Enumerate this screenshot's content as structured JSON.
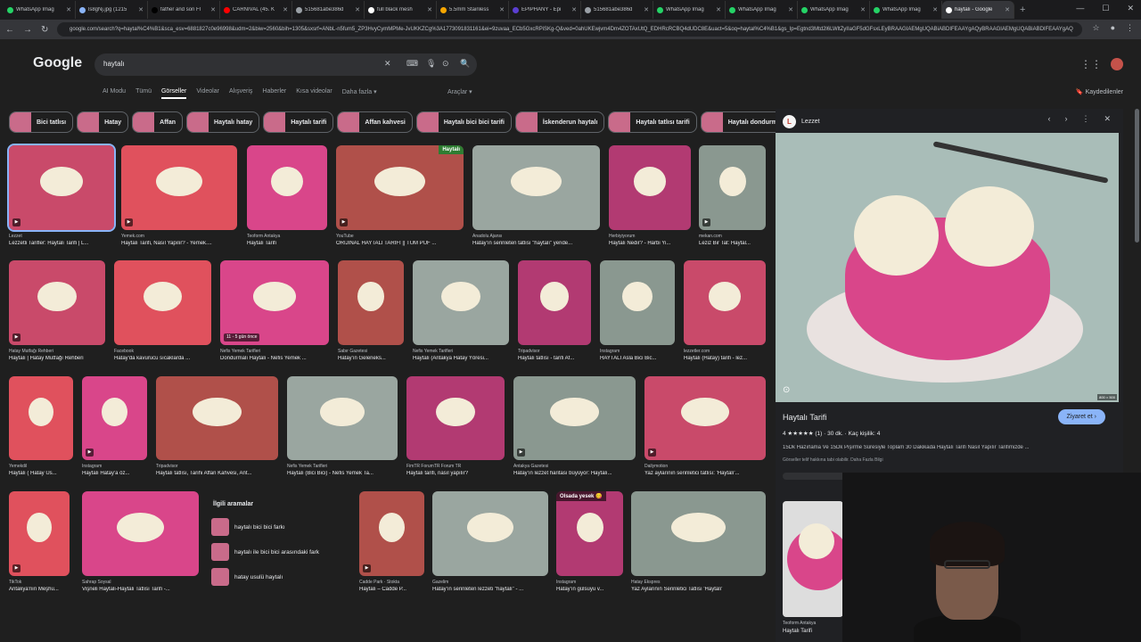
{
  "tabs": [
    {
      "label": "WhatsApp Imag",
      "color": "#25d366"
    },
    {
      "label": "ls8gNj.jpg (1215",
      "color": "#8ab4f8"
    },
    {
      "label": "father and son Fl",
      "color": "#000000"
    },
    {
      "label": "CARNIVAL (45. K",
      "color": "#ff0000"
    },
    {
      "label": "515681abe386d",
      "color": "#9aa0a6"
    },
    {
      "label": "full black mesh",
      "color": "#ffffff"
    },
    {
      "label": "5.5mm Stainless",
      "color": "#f7a600"
    },
    {
      "label": "EPIPHANY - Epi",
      "color": "#5b3fd1"
    },
    {
      "label": "515681abe386d",
      "color": "#9aa0a6"
    },
    {
      "label": "WhatsApp Imag",
      "color": "#25d366"
    },
    {
      "label": "WhatsApp Imag",
      "color": "#25d366"
    },
    {
      "label": "WhatsApp Imag",
      "color": "#25d366"
    },
    {
      "label": "WhatsApp Imag",
      "color": "#25d366"
    },
    {
      "label": "haytalı - Google",
      "color": "#ffffff"
    }
  ],
  "address": {
    "url": "google.com/search?q=haytal%C4%B1&sca_esv=6881827c0e96998&udm=2&biw=2560&bih=1305&sxsrf=ANbL-n5fum5_ZP3HvyCymMPMe-JvUKKZCg%3A1773091831161&ei=9zuvaa_ECb5GxcRPiSKg-Q&ved=0ahUKEwjvm4Dm4ZOTAxUtQ_EDHRcRCBQ4dUDC8E&uact=5&oq=haytal%C4%B1&gs_lp=Egtnd3Mtd2l6LWltZyIIaGF5dGFsxLEyBRAAGIAEMgUQABiABDIFEAAYgAQyBRAAGIAEMgUQABiABDIFEAAYgAQ"
  },
  "google": {
    "logo": "Google",
    "query": "haytalı"
  },
  "filters": [
    "AI Modu",
    "Tümü",
    "Görseller",
    "Videolar",
    "Alışveriş",
    "Haberler",
    "Kısa videolar",
    "Daha fazla ▾"
  ],
  "tools": "Araçlar ▾",
  "saved": "Kaydedilenler",
  "chips": [
    "Bici tatlısı",
    "Hatay",
    "Affan",
    "Haytalı hatay",
    "Haytalı tarifi",
    "Affan kahvesi",
    "Haytalı bici bici tarifi",
    "İskenderun haytalı",
    "Haytalı tatlısı tarifi",
    "Haytalı dondurma"
  ],
  "results": [
    {
      "src": "Lezzet",
      "title": "Lezzetli Tarifler: Haytalı Tarifi | L..."
    },
    {
      "src": "Yemek.com",
      "title": "Haytalı Tarifi, Nasıl Yapılır? - Yemek...."
    },
    {
      "src": "Teoform Antakya",
      "title": "Haytalı Tarifi"
    },
    {
      "src": "YouTube",
      "title": "ORİJİNAL HAYTALI TARİFİ || TÜM PÜF ..."
    },
    {
      "src": "Anadolu Ajansı",
      "title": "Hatay'ın serinleten tatlısı \"haytalı\" yeride..."
    },
    {
      "src": "Herbiyiyorum",
      "title": "Haytalı Nedir? - Harbi Yi..."
    },
    {
      "src": "mekan.com",
      "title": "Leziz Bir Tat: Haytal..."
    },
    {
      "src": "Hatay Mutfağı Rehberi",
      "title": "Haytalı | Hatay Mutfağı Rehberi"
    },
    {
      "src": "Facebook",
      "title": "Hatay'da kavurucu sıcaklarda ..."
    },
    {
      "src": "Nefis Yemek Tarifleri",
      "title": "Dondurmalı Haytalı - Nefis Yemek ..."
    },
    {
      "src": "Sabır Gazetesi",
      "title": "Hatay'ın Geleneks..."
    },
    {
      "src": "Nefis Yemek Tarifleri",
      "title": "Haytalı (Antakya Hatay Yöresi..."
    },
    {
      "src": "Tripadvisor",
      "title": "Haytalı tatlısı - tarifi Af..."
    },
    {
      "src": "Instagram",
      "title": "HAYTALI Asla Bici Bic..."
    },
    {
      "src": "lezzetler.com",
      "title": "Haytalı (Hatay) tarifi - lez..."
    },
    {
      "src": "Yemekdil",
      "title": "Haytalı ( Hatay Us..."
    },
    {
      "src": "Instagram",
      "title": "Haytalı Hatay'a öz..."
    },
    {
      "src": "Tripadvisor",
      "title": "Haytalı tatlısı, Tarihi Affan Kahvesi, Ant..."
    },
    {
      "src": "Nefis Yemek Tarifleri",
      "title": "Haytalı (Bici Bici) - Nefis Yemek Ta..."
    },
    {
      "src": "FimTR ForumTR Forum TR",
      "title": "Haytalı tarifi, nasıl yapılır?"
    },
    {
      "src": "Antakya Gazetesi",
      "title": "Hatay'ın lezzet haritası büyüyor: Haytalı..."
    },
    {
      "src": "Dailymotion",
      "title": "Yaz aylarının serinletici tatlısı: 'Haytalı'..."
    },
    {
      "src": "TikTok",
      "title": "Antakya'nın Meşhu..."
    },
    {
      "src": "Sahrap Soysal",
      "title": "Vişneli Haytalı-Haytalı Tatlısı Tarifi -..."
    },
    {
      "src": "Cadde Park · Stokta",
      "title": "Haytalı – Cadde P..."
    },
    {
      "src": "Gazelim",
      "title": "Hatay'ın serinleten lezzeti \"haytalı\" - ..."
    },
    {
      "src": "Instagram",
      "title": "Hatay'ın gülsuyu v..."
    },
    {
      "src": "Hatay Ekspres",
      "title": "Yaz Aylarının Serinletici Tatlısı 'Haytalı'"
    }
  ],
  "badges": {
    "haytali": "Haytalı",
    "ago": "11 - 5 gün önce",
    "olsada": "Olsada yesek 😋"
  },
  "related": {
    "title": "İlgili aramalar",
    "items": [
      "haytalı bici bici farkı",
      "haytalı ile bici bici arasındaki fark",
      "hatay usulü haytalı"
    ]
  },
  "panel": {
    "source": "Lezzet",
    "title": "Haytalı Tarifi",
    "visit": "Ziyaret et ›",
    "rating": "4 ★★★★★ (1) · 30 dk. · Kaç kişilik: 4",
    "desc": "15Dk Hazırlama Ve 15Dk Pişirme Süresiyle Toplam 30 Dakikada Haytalı Tarifi Nasıl Yapılır Tarifimizde ...",
    "note": "Görseller telif hakkına tabi olabilir. Daha Fazla Bilgi",
    "size": "800 × 500",
    "small_src": "Teoform Antakya",
    "small_title": "Haytalı Tarifi"
  }
}
